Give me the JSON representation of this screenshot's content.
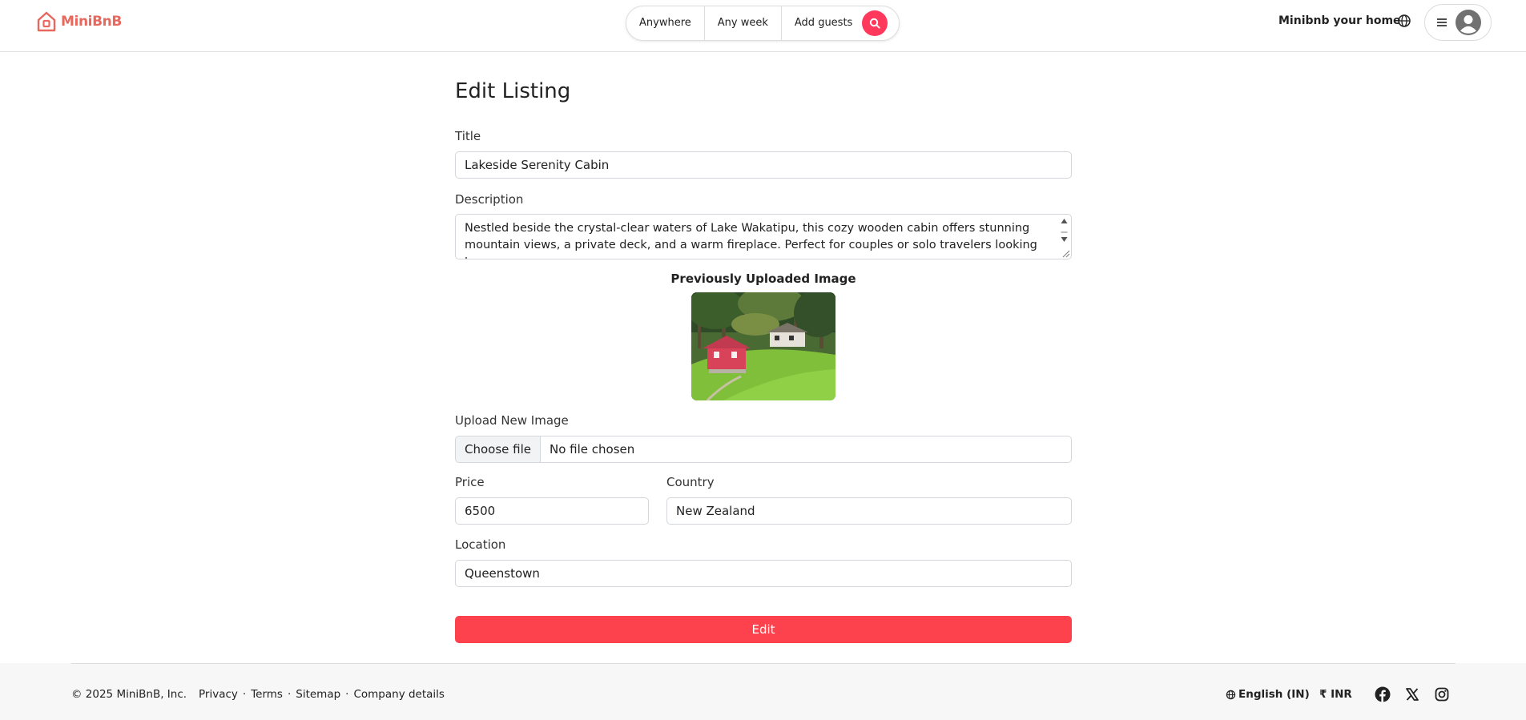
{
  "header": {
    "logo_text": "MiniBnB",
    "search": {
      "where": "Anywhere",
      "when": "Any week",
      "who": "Add guests"
    },
    "host_link": "Minibnb your home"
  },
  "form": {
    "page_title": "Edit Listing",
    "title_label": "Title",
    "title_value": "Lakeside Serenity Cabin",
    "description_label": "Description",
    "description_value": "Nestled beside the crystal-clear waters of Lake Wakatipu, this cozy wooden cabin offers stunning mountain views, a private deck, and a warm fireplace. Perfect for couples or solo travelers looking to",
    "previous_image_label": "Previously Uploaded Image",
    "upload_label": "Upload New Image",
    "file_button": "Choose file",
    "file_status": "No file chosen",
    "price_label": "Price",
    "price_value": "6500",
    "country_label": "Country",
    "country_value": "New Zealand",
    "location_label": "Location",
    "location_value": "Queenstown",
    "submit_label": "Edit"
  },
  "footer": {
    "copyright": "© 2025 MiniBnB, Inc.",
    "links": [
      "Privacy",
      "Terms",
      "Sitemap",
      "Company details"
    ],
    "separator": "·",
    "language": "English (IN)",
    "currency": "₹ INR"
  },
  "colors": {
    "brand": "#e8685e",
    "accent": "#ff385c",
    "submit": "#fe424d"
  },
  "icons": [
    "house-logo-icon",
    "search-icon",
    "globe-icon",
    "menu-icon",
    "avatar-icon",
    "facebook-icon",
    "x-icon",
    "instagram-icon"
  ]
}
